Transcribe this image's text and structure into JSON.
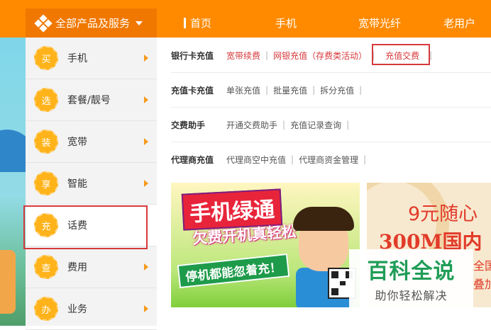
{
  "topnav": {
    "all_products": "全部产品及服务",
    "items": [
      "首页",
      "手机",
      "宽带光纤",
      "老用户"
    ]
  },
  "sidebar": {
    "items": [
      {
        "badge": "买",
        "label": "手机"
      },
      {
        "badge": "选",
        "label": "套餐/靓号"
      },
      {
        "badge": "装",
        "label": "宽带"
      },
      {
        "badge": "享",
        "label": "智能"
      },
      {
        "badge": "充",
        "label": "话费"
      },
      {
        "badge": "查",
        "label": "费用"
      },
      {
        "badge": "办",
        "label": "业务"
      }
    ]
  },
  "rows": [
    {
      "title": "银行卡充值",
      "links": [
        "宽带续费",
        "网银充值（存费类活动）",
        "充值交费"
      ]
    },
    {
      "title": "充值卡充值",
      "links": [
        "单张充值",
        "批量充值",
        "拆分充值"
      ]
    },
    {
      "title": "交费助手",
      "links": [
        "开通交费助手",
        "充值记录查询"
      ]
    },
    {
      "title": "代理商充值",
      "links": [
        "代理商空中充值",
        "代理商资金管理"
      ]
    }
  ],
  "banner1": {
    "title": "手机绿通",
    "subtitle": "欠费开机真轻松",
    "bottom": "停机都能忽着充！"
  },
  "banner2": {
    "line1": "9元随心",
    "line2": "300M国内",
    "line3": "全国",
    "line4": "叠加"
  },
  "watermark": {
    "brand": "百科全说",
    "sub": "助你轻松解决"
  },
  "colors": {
    "nav_orange": "#ff8a00",
    "badge_orange": "#ffb31a",
    "highlight_red": "#d6393c",
    "watermark_green": "#1f9d57"
  }
}
